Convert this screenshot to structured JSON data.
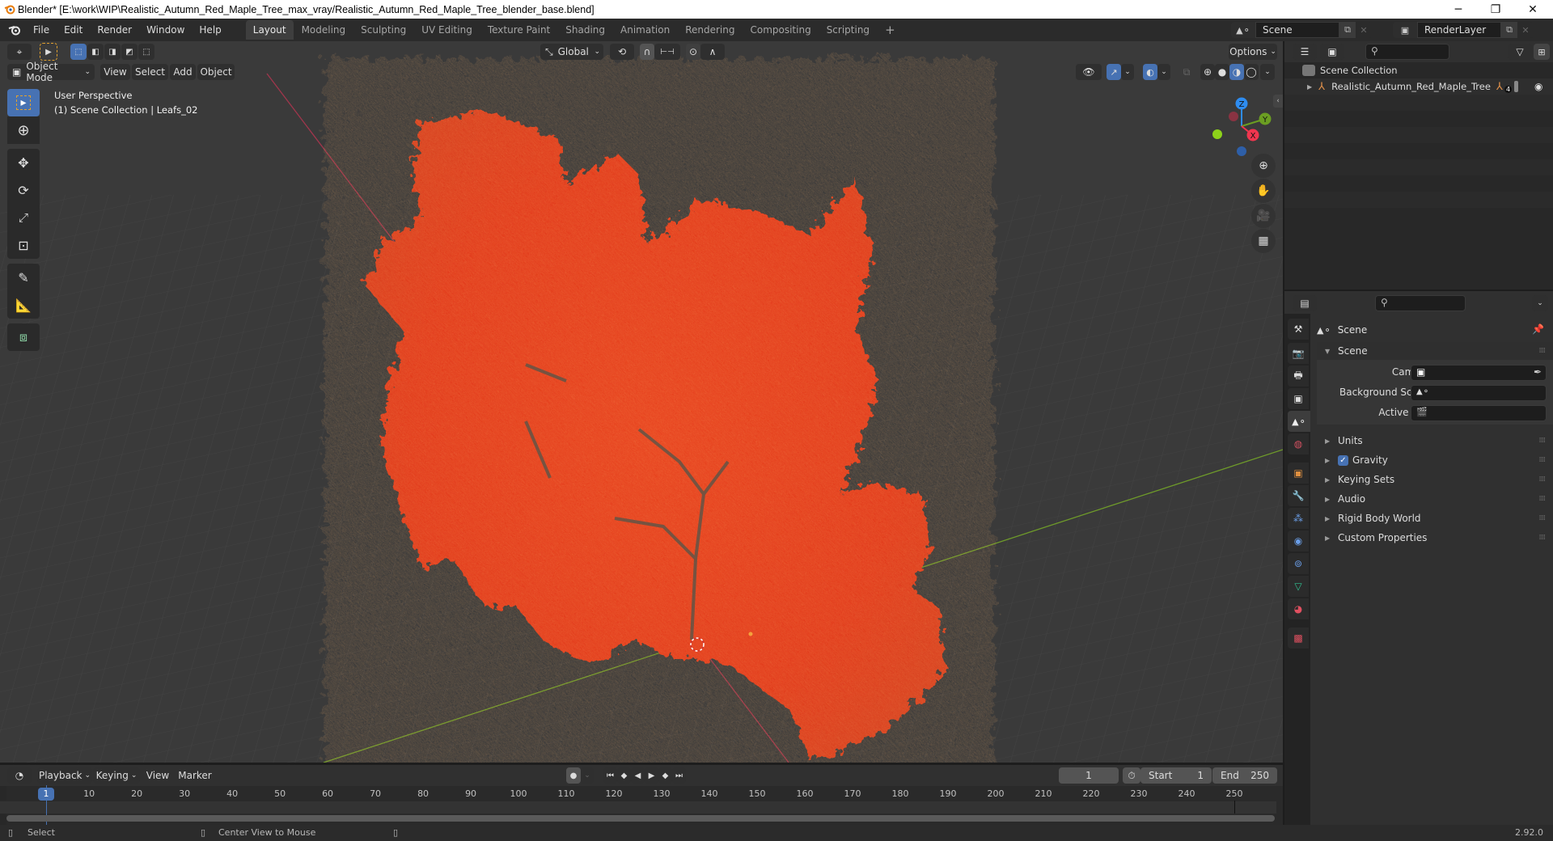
{
  "window": {
    "title": "Blender* [E:\\work\\WIP\\Realistic_Autumn_Red_Maple_Tree_max_vray/Realistic_Autumn_Red_Maple_Tree_blender_base.blend]",
    "minimize": "─",
    "maximize": "❐",
    "close": "✕"
  },
  "menubar": {
    "items": [
      "File",
      "Edit",
      "Render",
      "Window",
      "Help"
    ]
  },
  "workspaces": {
    "tabs": [
      "Layout",
      "Modeling",
      "Sculpting",
      "UV Editing",
      "Texture Paint",
      "Shading",
      "Animation",
      "Rendering",
      "Compositing",
      "Scripting"
    ],
    "active": "Layout",
    "add": "+"
  },
  "scene_selector": {
    "value": "Scene"
  },
  "viewlayer_selector": {
    "value": "RenderLayer"
  },
  "viewport": {
    "transform_orientation": "Global",
    "options_label": "Options",
    "mode": "Object Mode",
    "menus": [
      "View",
      "Select",
      "Add",
      "Object"
    ],
    "overlay_line1": "User Perspective",
    "overlay_line2": "(1) Scene Collection | Leafs_02",
    "gizmo_axes": {
      "x": "X",
      "y": "Y",
      "z": "Z"
    },
    "colors": {
      "x_axis": "#f0364f",
      "y_axis": "#6b9e22",
      "z_axis": "#2e8cf0",
      "foliage": "#e8401f",
      "selection": "#4772b3"
    }
  },
  "outliner": {
    "root": "Scene Collection",
    "items": [
      {
        "name": "Realistic_Autumn_Red_Maple_Tree",
        "child_count": "4"
      }
    ]
  },
  "properties": {
    "context_title": "Scene",
    "panel_title": "Scene",
    "fields": [
      {
        "label": "Camera",
        "value": ""
      },
      {
        "label": "Background Scene",
        "value": ""
      },
      {
        "label": "Active Clip",
        "value": ""
      }
    ],
    "sections": [
      {
        "label": "Units",
        "checkbox": false
      },
      {
        "label": "Gravity",
        "checkbox": true,
        "checked": true
      },
      {
        "label": "Keying Sets",
        "checkbox": false
      },
      {
        "label": "Audio",
        "checkbox": false
      },
      {
        "label": "Rigid Body World",
        "checkbox": false
      },
      {
        "label": "Custom Properties",
        "checkbox": false
      }
    ]
  },
  "timeline": {
    "menus": [
      "Playback",
      "Keying",
      "View",
      "Marker"
    ],
    "current_frame": "1",
    "start_label": "Start",
    "start": "1",
    "end_label": "End",
    "end": "250",
    "ticks": [
      "10",
      "20",
      "30",
      "40",
      "50",
      "60",
      "70",
      "80",
      "90",
      "100",
      "110",
      "120",
      "130",
      "140",
      "150",
      "160",
      "170",
      "180",
      "190",
      "200",
      "210",
      "220",
      "230",
      "240",
      "250"
    ],
    "playhead": "1"
  },
  "statusbar": {
    "left_action": "Select",
    "middle_action": "Center View to Mouse",
    "version": "2.92.0"
  }
}
